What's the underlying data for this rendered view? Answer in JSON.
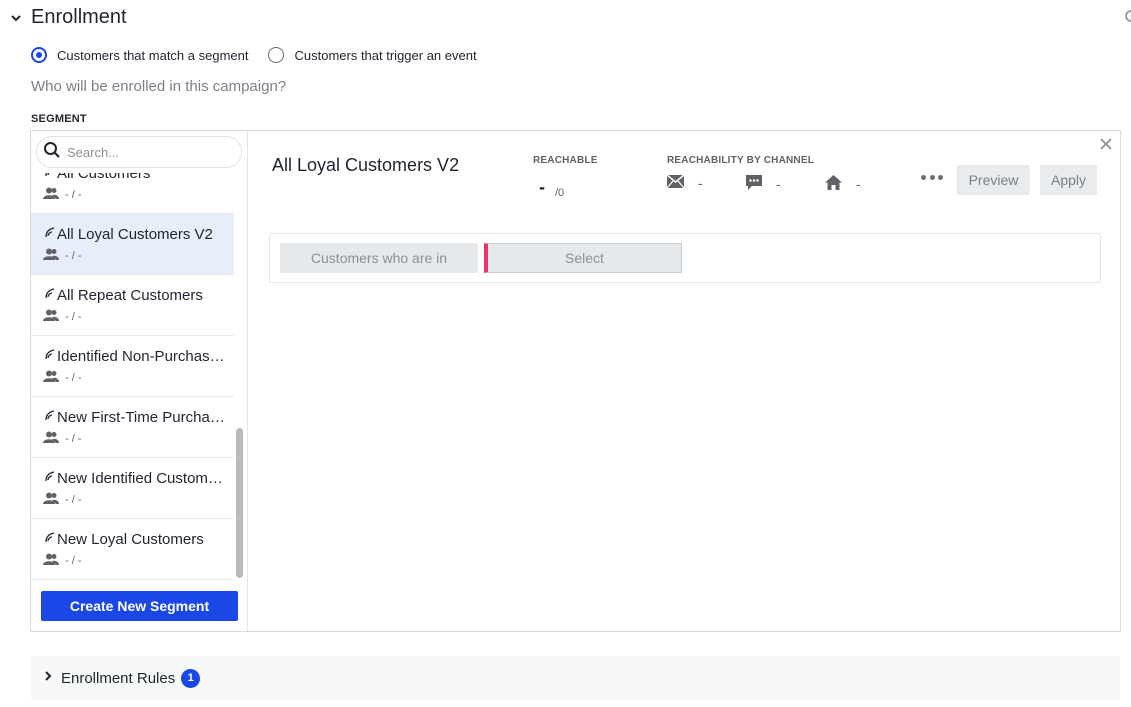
{
  "section": {
    "title": "Enrollment"
  },
  "enrollment_options": [
    {
      "label": "Customers that match a segment",
      "selected": true
    },
    {
      "label": "Customers that trigger an event",
      "selected": false
    }
  ],
  "question": "Who will be enrolled in this campaign?",
  "segment_label": "SEGMENT",
  "search": {
    "placeholder": "Search...",
    "value": ""
  },
  "segments": [
    {
      "name": "All Customers",
      "meta": "- / -"
    },
    {
      "name": "All Loyal Customers V2",
      "meta": "- / -",
      "selected": true
    },
    {
      "name": "All Repeat Customers",
      "meta": "- / -"
    },
    {
      "name": "Identified Non-Purchasers",
      "meta": "- / -"
    },
    {
      "name": "New First-Time Purchasers",
      "meta": "- / -"
    },
    {
      "name": "New Identified Customers",
      "meta": "- / -"
    },
    {
      "name": "New Loyal Customers",
      "meta": "- / -"
    }
  ],
  "create_button": "Create New Segment",
  "detail": {
    "title": "All Loyal Customers V2",
    "reachable_label": "REACHABLE",
    "reachable_value": "-",
    "reachable_total": "/0",
    "channel_label": "REACHABILITY BY CHANNEL",
    "channels": [
      {
        "icon": "email-icon",
        "value": "-"
      },
      {
        "icon": "sms-icon",
        "value": "-"
      },
      {
        "icon": "home-icon",
        "value": "-"
      }
    ],
    "preview_label": "Preview",
    "apply_label": "Apply",
    "rule_prefix": "Customers who are in",
    "rule_select": "Select"
  },
  "rules": {
    "title": "Enrollment Rules",
    "count": "1"
  },
  "colors": {
    "accent": "#1a47e6",
    "selected_bg": "#e8edfc",
    "rule_marker": "#e8336b"
  }
}
